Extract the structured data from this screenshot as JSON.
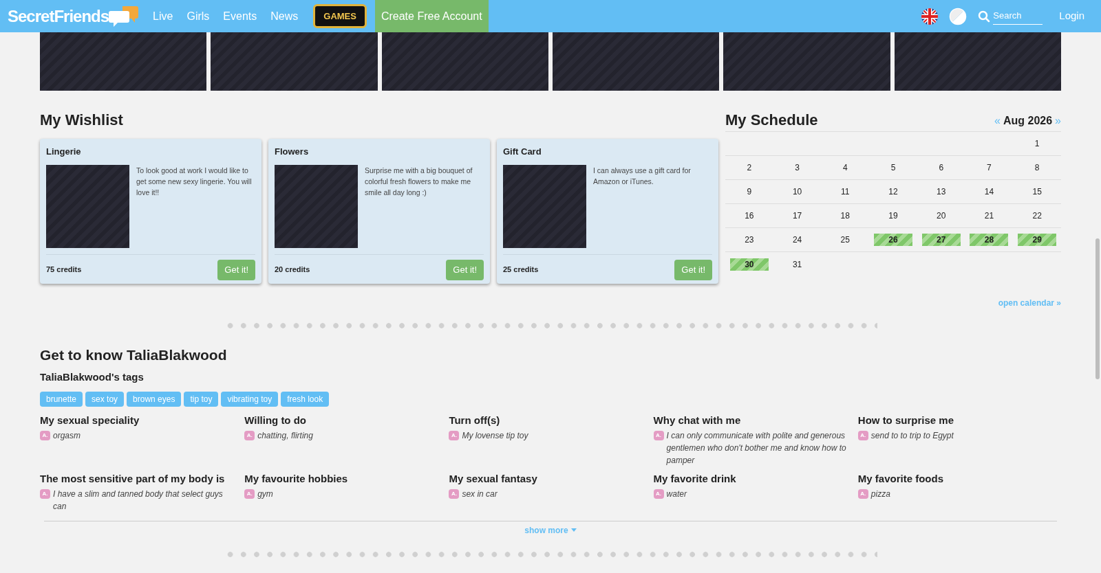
{
  "header": {
    "logo": "SecretFriends",
    "nav": [
      {
        "label": "Live",
        "kind": "link"
      },
      {
        "label": "Girls",
        "kind": "link"
      },
      {
        "label": "Events",
        "kind": "link"
      },
      {
        "label": "News",
        "kind": "link"
      },
      {
        "label": "GAMES",
        "kind": "games"
      },
      {
        "label": "Create Free Account",
        "kind": "cta"
      }
    ],
    "search": {
      "placeholder": "Search"
    },
    "login": "Login"
  },
  "wishlist": {
    "title": "My Wishlist",
    "items": [
      {
        "name": "Lingerie",
        "description": "To look good at work I would like to get some new sexy lingerie. You will love it!!",
        "price": "75 credits",
        "button": "Get it!"
      },
      {
        "name": "Flowers",
        "description": "Surprise me with a big bouquet of colorful fresh flowers to make me smile all day long :)",
        "price": "20 credits",
        "button": "Get it!"
      },
      {
        "name": "Gift Card",
        "description": "I can always use a gift card for Amazon or iTunes.",
        "price": "25 credits",
        "button": "Get it!"
      }
    ]
  },
  "schedule": {
    "title": "My Schedule",
    "prev": "«",
    "month": "Aug 2026",
    "next": "»",
    "weeks": [
      [
        {
          "day": "1",
          "booked": false
        }
      ],
      [
        {
          "day": "2",
          "booked": false
        },
        {
          "day": "3",
          "booked": false
        },
        {
          "day": "4",
          "booked": false
        },
        {
          "day": "5",
          "booked": false
        },
        {
          "day": "6",
          "booked": false
        },
        {
          "day": "7",
          "booked": false
        },
        {
          "day": "8",
          "booked": false
        }
      ],
      [
        {
          "day": "9",
          "booked": false
        },
        {
          "day": "10",
          "booked": false
        },
        {
          "day": "11",
          "booked": false
        },
        {
          "day": "12",
          "booked": false
        },
        {
          "day": "13",
          "booked": false
        },
        {
          "day": "14",
          "booked": false
        },
        {
          "day": "15",
          "booked": false
        }
      ],
      [
        {
          "day": "16",
          "booked": false
        },
        {
          "day": "17",
          "booked": false
        },
        {
          "day": "18",
          "booked": false
        },
        {
          "day": "19",
          "booked": false
        },
        {
          "day": "20",
          "booked": false
        },
        {
          "day": "21",
          "booked": false
        },
        {
          "day": "22",
          "booked": false
        }
      ],
      [
        {
          "day": "23",
          "booked": false
        },
        {
          "day": "24",
          "booked": false
        },
        {
          "day": "25",
          "booked": false
        },
        {
          "day": "26",
          "booked": true
        },
        {
          "day": "27",
          "booked": true
        },
        {
          "day": "28",
          "booked": true
        },
        {
          "day": "29",
          "booked": true
        }
      ],
      [
        {
          "day": "30",
          "booked": true
        },
        {
          "day": "31",
          "booked": false
        }
      ]
    ],
    "open_link": "open calendar »"
  },
  "profile": {
    "title": "Get to know TaliaBlakwood",
    "tags_title": "TaliaBlakwood's tags",
    "tags": [
      "brunette",
      "sex toy",
      "brown eyes",
      "tip toy",
      "vibrating toy",
      "fresh look"
    ],
    "facts": [
      {
        "question": "My sexual speciality",
        "badge": "A.",
        "answer": "orgasm"
      },
      {
        "question": "Willing to do",
        "badge": "A.",
        "answer": "chatting, flirting"
      },
      {
        "question": "Turn off(s)",
        "badge": "A.",
        "answer": "My lovense tip toy"
      },
      {
        "question": "Why chat with me",
        "badge": "A.",
        "answer": "I can only communicate with polite and generous gentlemen who don't bother me and know how to pamper"
      },
      {
        "question": "How to surprise me",
        "badge": "A.",
        "answer": "send to to trip to Egypt"
      },
      {
        "question": "The most sensitive part of my body is",
        "badge": "A.",
        "answer": "I have a slim and tanned body that select guys can"
      },
      {
        "question": "My favourite hobbies",
        "badge": "A.",
        "answer": "gym"
      },
      {
        "question": "My sexual fantasy",
        "badge": "A.",
        "answer": "sex in car"
      },
      {
        "question": "My favorite drink",
        "badge": "A.",
        "answer": "water"
      },
      {
        "question": "My favorite foods",
        "badge": "A.",
        "answer": "pizza"
      }
    ],
    "show_more": "show more"
  }
}
